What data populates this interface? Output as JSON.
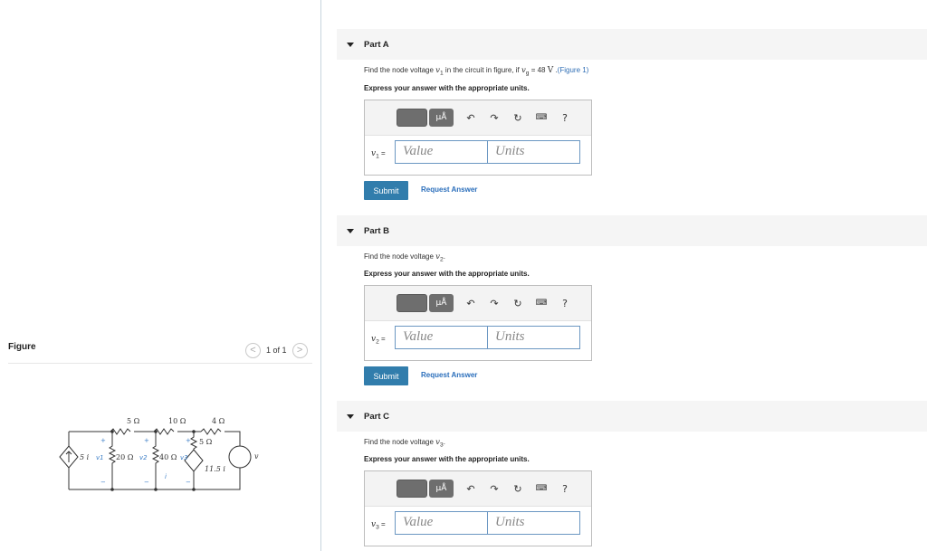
{
  "figure": {
    "title": "Figure",
    "pager": {
      "prev": "<",
      "label": "1 of 1",
      "next": ">"
    },
    "circuit": {
      "resistors_top": [
        "5 Ω",
        "10 Ω",
        "4 Ω"
      ],
      "resistors_mid": [
        "20 Ω",
        "40 Ω",
        "5 Ω"
      ],
      "dependent_sources": [
        "5 i",
        "11.5 i"
      ],
      "node_labels": [
        "v1",
        "v2",
        "v3"
      ],
      "source_label": "v",
      "current_label": "i"
    }
  },
  "parts": [
    {
      "title": "Part A",
      "question_prefix": "Find the node voltage ",
      "question_var": "v",
      "question_sub": "1",
      "question_mid": " in the circuit in figure, if ",
      "question_var2": "v",
      "question_sub2": "g",
      "question_val": " = 48 ",
      "question_unit": "V",
      "question_tail": " .",
      "figure_link": "(Figure 1)",
      "instruction": "Express your answer with the appropriate units.",
      "var_label": "v",
      "var_sub": "1",
      "value_placeholder": "Value",
      "units_placeholder": "Units",
      "submit": "Submit",
      "request": "Request Answer"
    },
    {
      "title": "Part B",
      "question_prefix": "Find the node voltage ",
      "question_var": "v",
      "question_sub": "2",
      "question_tail": ".",
      "instruction": "Express your answer with the appropriate units.",
      "var_label": "v",
      "var_sub": "2",
      "value_placeholder": "Value",
      "units_placeholder": "Units",
      "submit": "Submit",
      "request": "Request Answer"
    },
    {
      "title": "Part C",
      "question_prefix": "Find the node voltage ",
      "question_var": "v",
      "question_sub": "3",
      "question_tail": ".",
      "instruction": "Express your answer with the appropriate units.",
      "var_label": "v",
      "var_sub": "3",
      "value_placeholder": "Value",
      "units_placeholder": "Units"
    }
  ],
  "toolbar": {
    "units_button": "μÅ",
    "icons": [
      "undo-icon",
      "redo-icon",
      "reset-icon",
      "keyboard-icon",
      "help-icon"
    ],
    "help": "?"
  },
  "colors": {
    "accent": "#317dac",
    "link": "#2a6ebb",
    "input_border": "#6b97c2"
  }
}
